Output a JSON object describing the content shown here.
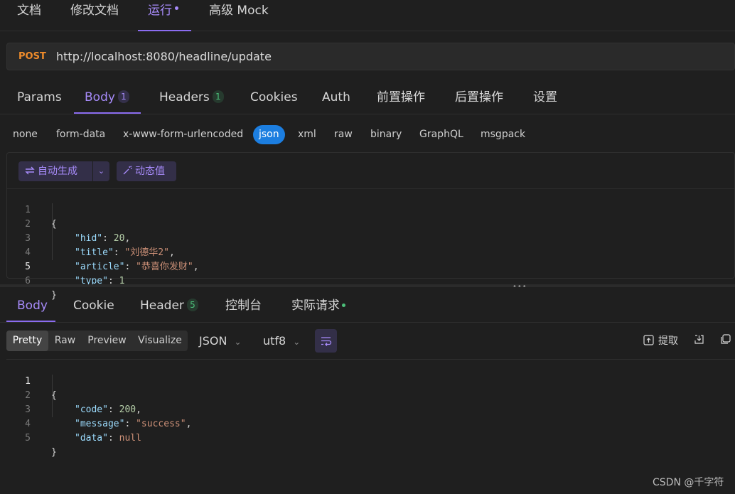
{
  "top_tabs": {
    "doc": "文档",
    "edit_doc": "修改文档",
    "run": "运行",
    "mock": "高级 Mock"
  },
  "request": {
    "method": "POST",
    "url": "http://localhost:8080/headline/update"
  },
  "request_tabs": {
    "params": "Params",
    "body": "Body",
    "body_count": "1",
    "headers": "Headers",
    "headers_count": "1",
    "cookies": "Cookies",
    "auth": "Auth",
    "pre": "前置操作",
    "post": "后置操作",
    "settings": "设置"
  },
  "body_types": [
    "none",
    "form-data",
    "x-www-form-urlencoded",
    "json",
    "xml",
    "raw",
    "binary",
    "GraphQL",
    "msgpack"
  ],
  "body_type_selected": "json",
  "editor_toolbar": {
    "auto_generate": "自动生成",
    "dynamic_value": "动态值"
  },
  "request_body_lines": [
    {
      "no": "1",
      "text": "{"
    },
    {
      "no": "2",
      "key": "\"hid\"",
      "value": "20",
      "value_type": "number",
      "trail": ","
    },
    {
      "no": "3",
      "key": "\"title\"",
      "value": "\"刘德华2\"",
      "value_type": "string",
      "trail": ","
    },
    {
      "no": "4",
      "key": "\"article\"",
      "value": "\"恭喜你发财\"",
      "value_type": "string",
      "trail": ","
    },
    {
      "no": "5",
      "key": "\"type\"",
      "value": "1",
      "value_type": "number",
      "trail": ""
    },
    {
      "no": "6",
      "text": "}"
    }
  ],
  "response_tabs": {
    "body": "Body",
    "cookie": "Cookie",
    "header": "Header",
    "header_count": "5",
    "console": "控制台",
    "actual_request": "实际请求"
  },
  "response_view": {
    "modes": [
      "Pretty",
      "Raw",
      "Preview",
      "Visualize"
    ],
    "selected_mode": "Pretty",
    "format": "JSON",
    "encoding": "utf8",
    "extract": "提取"
  },
  "response_body_lines": [
    {
      "no": "1",
      "text": "{"
    },
    {
      "no": "2",
      "key": "\"code\"",
      "value": "200",
      "value_type": "number",
      "trail": ","
    },
    {
      "no": "3",
      "key": "\"message\"",
      "value": "\"success\"",
      "value_type": "string",
      "trail": ","
    },
    {
      "no": "4",
      "key": "\"data\"",
      "value": "null",
      "value_type": "null",
      "trail": ""
    },
    {
      "no": "5",
      "text": "}"
    }
  ],
  "watermark": "CSDN @千字符",
  "colors": {
    "accent": "#a78bfa",
    "method_post": "#f08c2b",
    "json_selected": "#1c7ee0",
    "badge_green": "#4cc17a"
  }
}
